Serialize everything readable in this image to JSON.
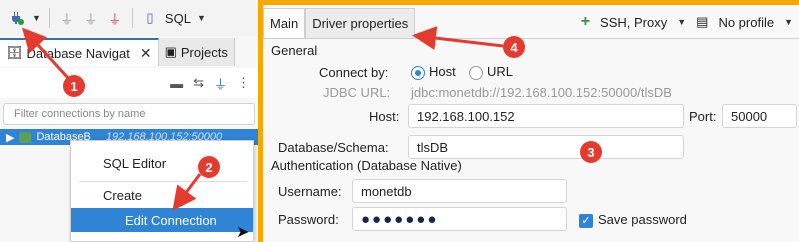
{
  "toolbar": {
    "sql_label": "SQL"
  },
  "left_tabs": [
    {
      "label": "Database Navigat"
    },
    {
      "label": "Projects"
    }
  ],
  "filter": {
    "placeholder": "Filter connections by name"
  },
  "tree": {
    "name": "DatabaseB",
    "host": "192.168.100.152:50000"
  },
  "context_menu": {
    "items": [
      "SQL Editor",
      "Create",
      "Edit Connection"
    ]
  },
  "dialog": {
    "tabs": [
      "Main",
      "Driver properties"
    ],
    "ssh_label": "SSH, Proxy",
    "profile_label": "No profile",
    "general_label": "General",
    "connect_by_label": "Connect by:",
    "host_option": "Host",
    "url_option": "URL",
    "jdbc_label": "JDBC URL:",
    "jdbc_value": "jdbc:monetdb://192.168.100.152:50000/tlsDB",
    "host_label": "Host:",
    "host_value": "192.168.100.152",
    "port_label": "Port:",
    "port_value": "50000",
    "db_label": "Database/Schema:",
    "db_value": "tlsDB",
    "auth_label": "Authentication (Database Native)",
    "username_label": "Username:",
    "username_value": "monetdb",
    "password_label": "Password:",
    "password_value": "●●●●●●●",
    "save_password_label": "Save password"
  },
  "annotations": [
    "1",
    "2",
    "3",
    "4"
  ],
  "colors": {
    "accent": "#2f84d6",
    "frame": "#f5a800",
    "annotation": "#e53b2f"
  }
}
